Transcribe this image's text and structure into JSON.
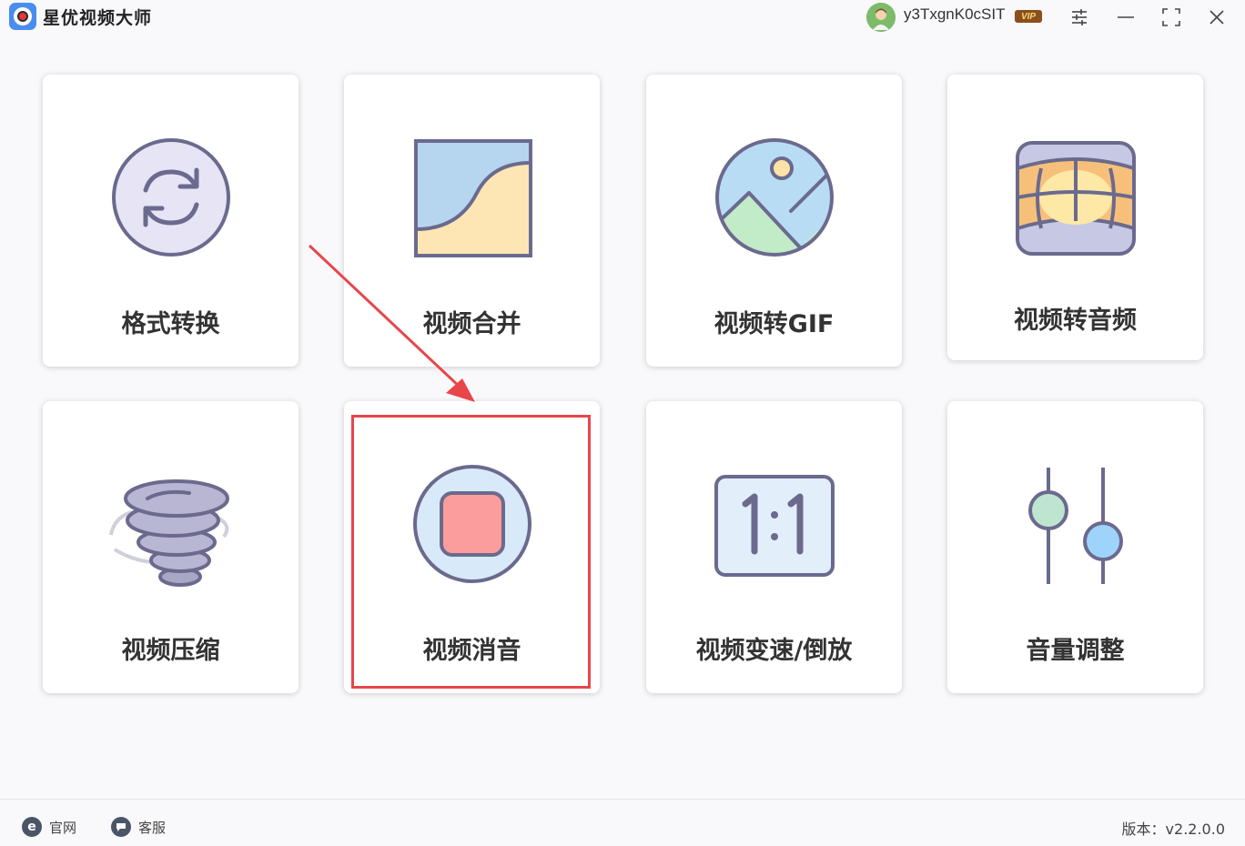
{
  "app": {
    "title": "星优视频大师"
  },
  "user": {
    "name": "y3TxgnK0cSIT",
    "badge": "VIP"
  },
  "window_controls": [
    "settings-icon",
    "minimize-icon",
    "maximize-icon",
    "close-icon"
  ],
  "tools": [
    {
      "label": "格式转换",
      "icon": "convert-icon"
    },
    {
      "label": "视频合并",
      "icon": "merge-icon"
    },
    {
      "label": "视频转GIF",
      "icon": "gif-icon"
    },
    {
      "label": "视频转音频",
      "icon": "audio-icon"
    },
    {
      "label": "视频压缩",
      "icon": "compress-icon"
    },
    {
      "label": "视频消音",
      "icon": "mute-icon"
    },
    {
      "label": "视频变速/倒放",
      "icon": "ratio-icon"
    },
    {
      "label": "音量调整",
      "icon": "volume-icon"
    }
  ],
  "footer": {
    "website_label": "官网",
    "support_label": "客服",
    "version": "版本：v2.2.0.0"
  },
  "colors": {
    "highlight": "#e8464a",
    "icon_stroke": "#6b6a8e"
  }
}
